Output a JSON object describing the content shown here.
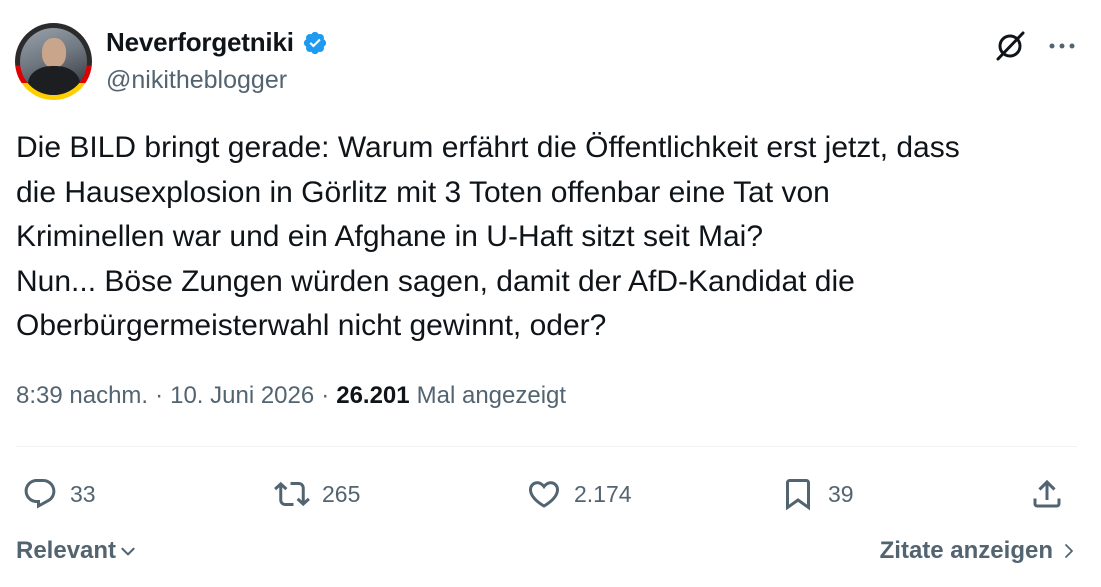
{
  "author": {
    "display_name": "Neverforgetniki",
    "handle": "@nikitheblogger",
    "verified": true
  },
  "tweet": {
    "text": "Die BILD bringt gerade: Warum erfährt die Öffentlichkeit erst jetzt, dass\ndie Hausexplosion in Görlitz mit 3 Toten offenbar eine Tat von\nKriminellen war und ein Afghane in U-Haft sitzt seit Mai?\nNun... Böse Zungen würden sagen, damit der AfD-Kandidat die\nOberbürgermeisterwahl nicht gewinnt, oder?",
    "time": "8:39 nachm.",
    "date": "10. Juni 2026",
    "separator": "·",
    "views_count": "26.201",
    "views_label": "Mal angezeigt"
  },
  "actions": {
    "replies": "33",
    "reposts": "265",
    "likes": "2.174",
    "bookmarks": "39"
  },
  "footer": {
    "sort_label": "Relevant",
    "quotes_label": "Zitate anzeigen"
  },
  "colors": {
    "text_primary": "#0f1419",
    "text_secondary": "#536471",
    "verified_blue": "#1d9bf0",
    "divider": "#eff3f4"
  },
  "icons": {
    "verified": "verified-badge-icon",
    "grok": "grok-icon",
    "more": "more-horizontal-icon",
    "reply": "reply-icon",
    "repost": "repost-icon",
    "like": "heart-icon",
    "bookmark": "bookmark-icon",
    "share": "share-icon"
  }
}
